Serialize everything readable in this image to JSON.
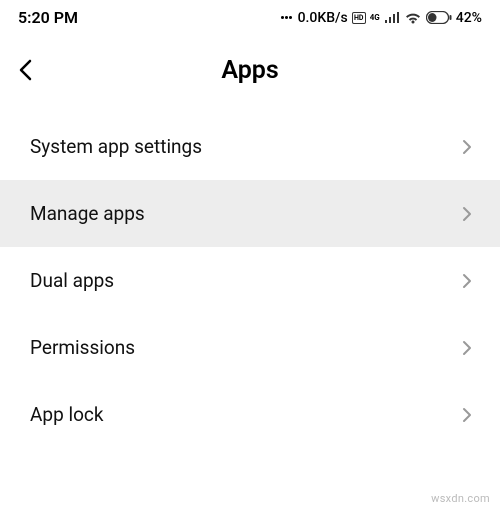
{
  "status_bar": {
    "time": "5:20 PM",
    "data_rate": "0.0KB/s",
    "network_label": "4G",
    "battery_percent": "42%"
  },
  "header": {
    "title": "Apps"
  },
  "list": {
    "items": [
      {
        "label": "System app settings",
        "highlighted": false
      },
      {
        "label": "Manage apps",
        "highlighted": true
      },
      {
        "label": "Dual apps",
        "highlighted": false
      },
      {
        "label": "Permissions",
        "highlighted": false
      },
      {
        "label": "App lock",
        "highlighted": false
      }
    ]
  },
  "watermark": "wsxdn.com"
}
